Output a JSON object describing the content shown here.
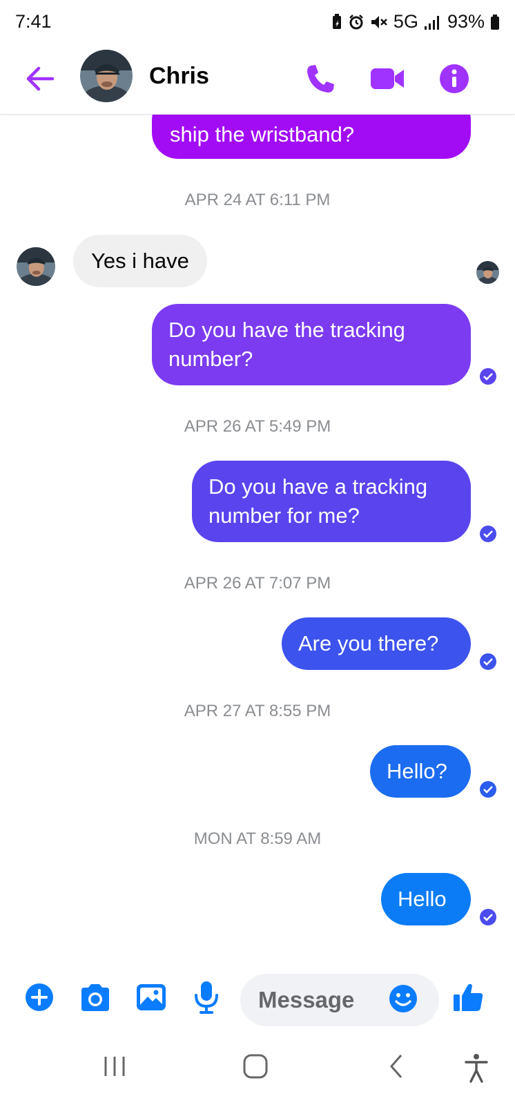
{
  "status_bar": {
    "time": "7:41",
    "network": "5G",
    "battery": "93%"
  },
  "header": {
    "contact_name": "Chris",
    "icons": [
      "back-arrow-icon",
      "phone-icon",
      "video-icon",
      "info-icon"
    ]
  },
  "messages": [
    {
      "type": "out",
      "text": "ship the wristband?"
    },
    {
      "type": "timestamp",
      "text": "APR 24 AT 6:11 PM"
    },
    {
      "type": "in",
      "text": "Yes i have"
    },
    {
      "type": "out",
      "text_lines": [
        "Do you have the tracking",
        "number?"
      ]
    },
    {
      "type": "timestamp",
      "text": "APR 26 AT 5:49 PM"
    },
    {
      "type": "out",
      "text_lines": [
        "Do you have a tracking",
        "number for me?"
      ]
    },
    {
      "type": "timestamp",
      "text": "APR 26 AT 7:07 PM"
    },
    {
      "type": "out",
      "text": "Are you there?"
    },
    {
      "type": "timestamp",
      "text": "APR 27 AT 8:55 PM"
    },
    {
      "type": "out",
      "text": "Hello?"
    },
    {
      "type": "timestamp",
      "text": "MON AT 8:59 AM"
    },
    {
      "type": "out",
      "text": "Hello"
    }
  ],
  "composer": {
    "placeholder": "Message",
    "icons": [
      "plus-icon",
      "camera-icon",
      "gallery-icon",
      "microphone-icon",
      "emoji-icon",
      "thumbs-up-icon"
    ]
  },
  "colors": {
    "accent_purple": "#a033ff",
    "bubble_1": "#a20cf5",
    "bubble_2": "#7c3bf0",
    "bubble_3": "#5a44ee",
    "bubble_4": "#3c53ee",
    "bubble_5": "#1b6cf0",
    "bubble_6": "#0b7cf5",
    "composer_blue": "#0a7cff"
  }
}
